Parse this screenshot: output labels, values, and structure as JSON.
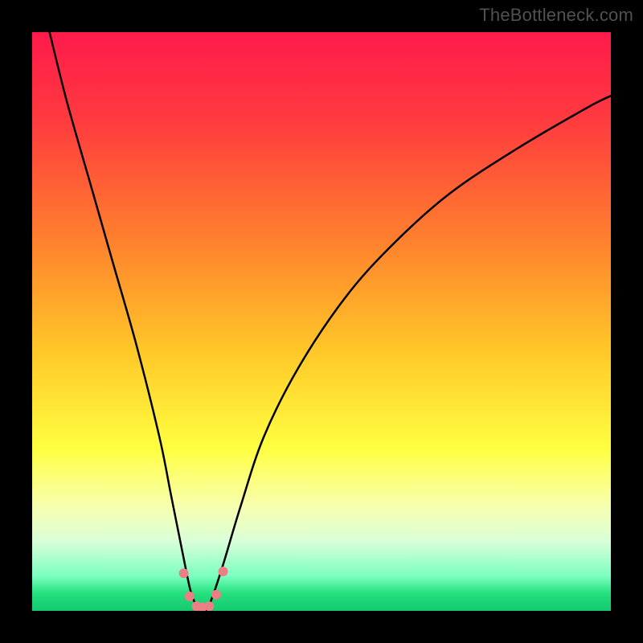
{
  "watermark": "TheBottleneck.com",
  "chart_data": {
    "type": "line",
    "title": "",
    "xlabel": "",
    "ylabel": "",
    "xlim": [
      0,
      100
    ],
    "ylim": [
      0,
      100
    ],
    "gradient_stops": [
      {
        "offset": 0,
        "color": "#ff1b4b"
      },
      {
        "offset": 0.15,
        "color": "#ff3a3f"
      },
      {
        "offset": 0.35,
        "color": "#ff7d2e"
      },
      {
        "offset": 0.55,
        "color": "#ffc728"
      },
      {
        "offset": 0.72,
        "color": "#ffff41"
      },
      {
        "offset": 0.82,
        "color": "#f7ffb0"
      },
      {
        "offset": 0.88,
        "color": "#d9ffd9"
      },
      {
        "offset": 0.94,
        "color": "#7bffbf"
      },
      {
        "offset": 0.97,
        "color": "#24e07e"
      },
      {
        "offset": 1.0,
        "color": "#14c96f"
      }
    ],
    "series": [
      {
        "name": "bottleneck-curve",
        "x": [
          3,
          6,
          10,
          14,
          18,
          22,
          24,
          26,
          27.5,
          29,
          30,
          31,
          33,
          36,
          40,
          46,
          54,
          62,
          72,
          84,
          96,
          100
        ],
        "y": [
          100,
          88,
          74,
          60,
          46,
          30,
          20,
          10,
          3,
          0,
          0,
          2,
          8,
          18,
          30,
          42,
          54,
          63,
          72,
          80,
          87,
          89
        ]
      }
    ],
    "trough_markers": {
      "color": "#ed7e83",
      "radius": 6,
      "points": [
        {
          "x": 26.2,
          "y": 6.5
        },
        {
          "x": 27.2,
          "y": 2.5
        },
        {
          "x": 28.4,
          "y": 0.8
        },
        {
          "x": 29.4,
          "y": 0.6
        },
        {
          "x": 30.6,
          "y": 0.8
        },
        {
          "x": 31.8,
          "y": 2.8
        },
        {
          "x": 33.0,
          "y": 6.8
        }
      ]
    }
  }
}
